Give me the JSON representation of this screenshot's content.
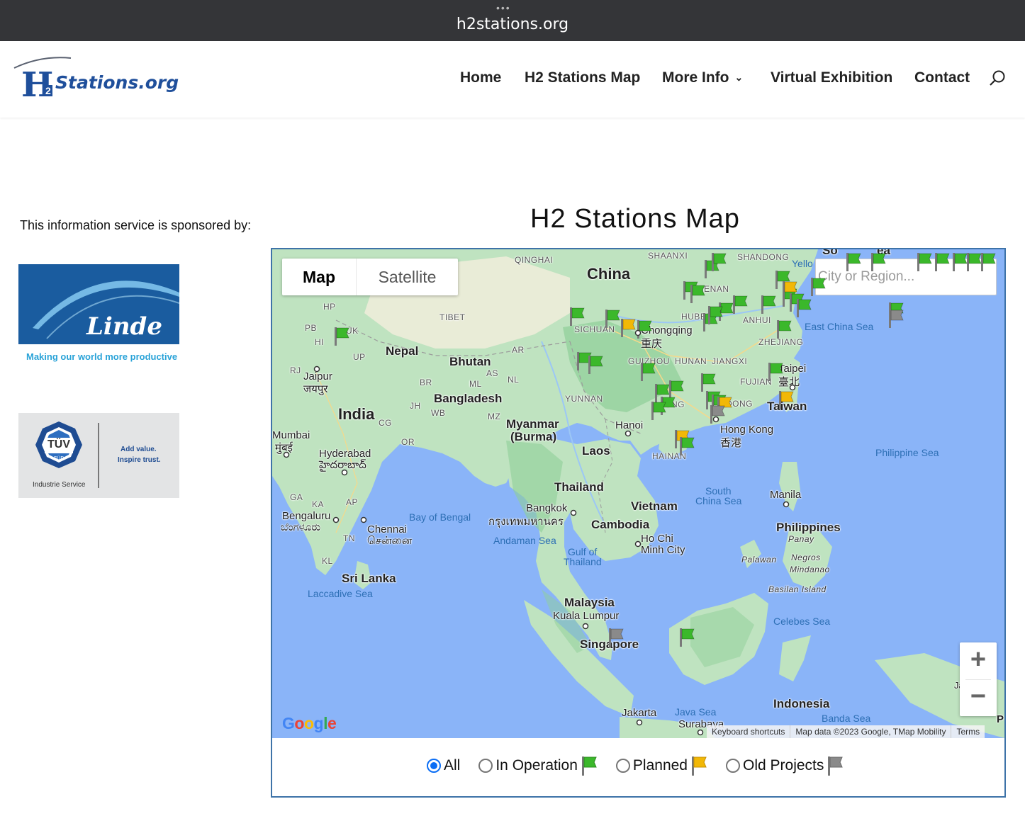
{
  "browser": {
    "url": "h2stations.org",
    "more_dots": "•••"
  },
  "site": {
    "logo": {
      "h": "H",
      "two": "2",
      "rest": "Stations.org"
    },
    "nav": {
      "home": "Home",
      "map": "H2 Stations Map",
      "more_info": "More Info",
      "virtual": "Virtual Exhibition",
      "contact": "Contact"
    }
  },
  "sidebar": {
    "sponsor_text": "This information service is sponsored by:",
    "linde": {
      "wordmark": "Linde",
      "tagline": "Making our world more productive"
    },
    "tuv": {
      "mark": "TÜV",
      "sub": "SÜD",
      "division": "Industrie Service",
      "slogan1": "Add value.",
      "slogan2": "Inspire trust."
    }
  },
  "main": {
    "title": "H2 Stations Map",
    "map": {
      "type_map": "Map",
      "type_satellite": "Satellite",
      "search_placeholder": "City or Region...",
      "zoom_in": "+",
      "zoom_out": "−",
      "google": "Google",
      "attribution": {
        "shortcuts": "Keyboard shortcuts",
        "data": "Map data ©2023 Google, TMap Mobility",
        "terms": "Terms"
      },
      "labels": {
        "china": "China",
        "india": "India",
        "nepal": "Nepal",
        "bhutan": "Bhutan",
        "bangladesh": "Bangladesh",
        "myanmar": "Myanmar",
        "burma": "(Burma)",
        "laos": "Laos",
        "thailand": "Thailand",
        "vietnam": "Vietnam",
        "cambodia": "Cambodia",
        "philippines": "Philippines",
        "malaysia": "Malaysia",
        "indonesia": "Indonesia",
        "srilanka": "Sri Lanka",
        "taiwan": "Taiwan",
        "singapore": "Singapore",
        "chongqing": "Chongqing",
        "chongqing_zh": "重庆",
        "hongkong": "Hong Kong",
        "hongkong_zh": "香港",
        "taipei": "Taipei",
        "taipei_zh": "臺北",
        "hanoi": "Hanoi",
        "bangkok": "Bangkok",
        "bangkok_th": "กรุงเทพมหานคร",
        "hcmc1": "Ho Chi",
        "hcmc2": "Minh City",
        "manila": "Manila",
        "kl": "Kuala Lumpur",
        "jakarta": "Jakarta",
        "surabaya": "Surabaya",
        "jaipur": "Jaipur",
        "jaipur_hi": "जयपुर",
        "mumbai": "Mumbai",
        "mumbai_mr": "मुंबई",
        "hyderabad": "Hyderabad",
        "hyderabad_te": "హైదరాబాద్",
        "bengaluru": "Bengaluru",
        "bengaluru_kn": "ಬೆಂಗಳೂರು",
        "chennai": "Chennai",
        "chennai_ta": "சென்னை",
        "qinghai": "QINGHAI",
        "shaanxi": "SHAANXI",
        "shandong": "SHANDONG",
        "henan": "HENAN",
        "hubei": "HUBEI",
        "anhui": "ANHUI",
        "sichuan": "SICHUAN",
        "zhejiang": "ZHEJIANG",
        "guizhou": "GUIZHOU",
        "hunan": "HUNAN",
        "jiangxi": "JIANGXI",
        "fujian": "FUJIAN",
        "yunnan": "YUNNAN",
        "guangdong": "DONG",
        "guangxi": "JANG",
        "hainan": "HAINAN",
        "tibet": "TIBET",
        "hp": "HP",
        "pb": "PB",
        "hi": "HI",
        "uk": "UK",
        "up": "UP",
        "rj": "RJ",
        "br": "BR",
        "jh": "JH",
        "wb": "WB",
        "cg": "CG",
        "or": "OR",
        "ar": "AR",
        "as": "AS",
        "nl": "NL",
        "ml": "ML",
        "mz": "MZ",
        "ga": "GA",
        "ka": "KA",
        "ap": "AP",
        "tn": "TN",
        "kl_state": "KL",
        "panay": "Panay",
        "negros": "Negros",
        "mindanao": "Mindanao",
        "palawan": "Palawan",
        "basilan": "Basilan Island",
        "east_china_sea": "East China Sea",
        "yellow": "Yello",
        "philippine_sea": "Philippine Sea",
        "south_china_sea1": "South",
        "south_china_sea2": "China Sea",
        "bay_of_bengal": "Bay of Bengal",
        "andaman": "Andaman Sea",
        "gulf1": "Gulf of",
        "gulf2": "Thailand",
        "laccadive": "Laccadive Sea",
        "celebes": "Celebes Sea",
        "java_sea": "Java Sea",
        "banda": "Banda Sea",
        "so": "So",
        "ea": "ea",
        "ja": "Ja",
        "p": "P"
      }
    },
    "filters": {
      "all": "All",
      "in_operation": "In Operation",
      "planned": "Planned",
      "old": "Old Projects",
      "selected": "All"
    },
    "colors": {
      "operation": "#3bb82b",
      "planned": "#f2b807",
      "old": "#8a8a8a",
      "accent": "#0b6ef5",
      "border": "#3e73a8"
    }
  }
}
